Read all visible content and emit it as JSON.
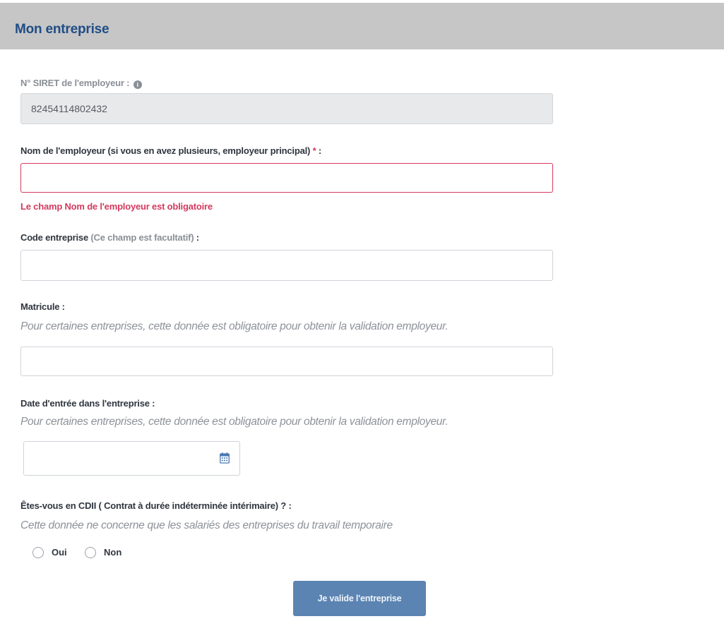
{
  "header": {
    "title": "Mon entreprise"
  },
  "siret": {
    "label": "N° SIRET de l'employeur :",
    "value": "82454114802432"
  },
  "employer_name": {
    "label": "Nom de l'employeur (si vous en avez plusieurs, employeur principal)",
    "required_mark": "*",
    "suffix": " :",
    "value": "",
    "error": "Le champ Nom de l'employeur est obligatoire"
  },
  "company_code": {
    "label": "Code entreprise",
    "note": "(Ce champ est facultatif)",
    "suffix": " :",
    "value": ""
  },
  "matricule": {
    "label": "Matricule :",
    "hint": "Pour certaines entreprises, cette donnée est obligatoire pour obtenir la validation employeur.",
    "value": ""
  },
  "entry_date": {
    "label": "Date d'entrée dans l'entreprise :",
    "hint": "Pour certaines entreprises, cette donnée est obligatoire pour obtenir la validation employeur.",
    "value": ""
  },
  "cdii": {
    "label": "Êtes-vous en CDII ( Contrat à durée indéterminée intérimaire) ? :",
    "hint": "Cette donnée ne concerne que les salariés des entreprises du travail temporaire",
    "options": [
      "Oui",
      "Non"
    ]
  },
  "submit": {
    "label": "Je valide l'entreprise"
  },
  "colors": {
    "header_bg": "#c6c6c6",
    "header_text": "#1f4d86",
    "error": "#d33a5e",
    "button": "#5b84b2"
  },
  "icons": {
    "info": "info-icon",
    "calendar": "calendar-icon"
  }
}
